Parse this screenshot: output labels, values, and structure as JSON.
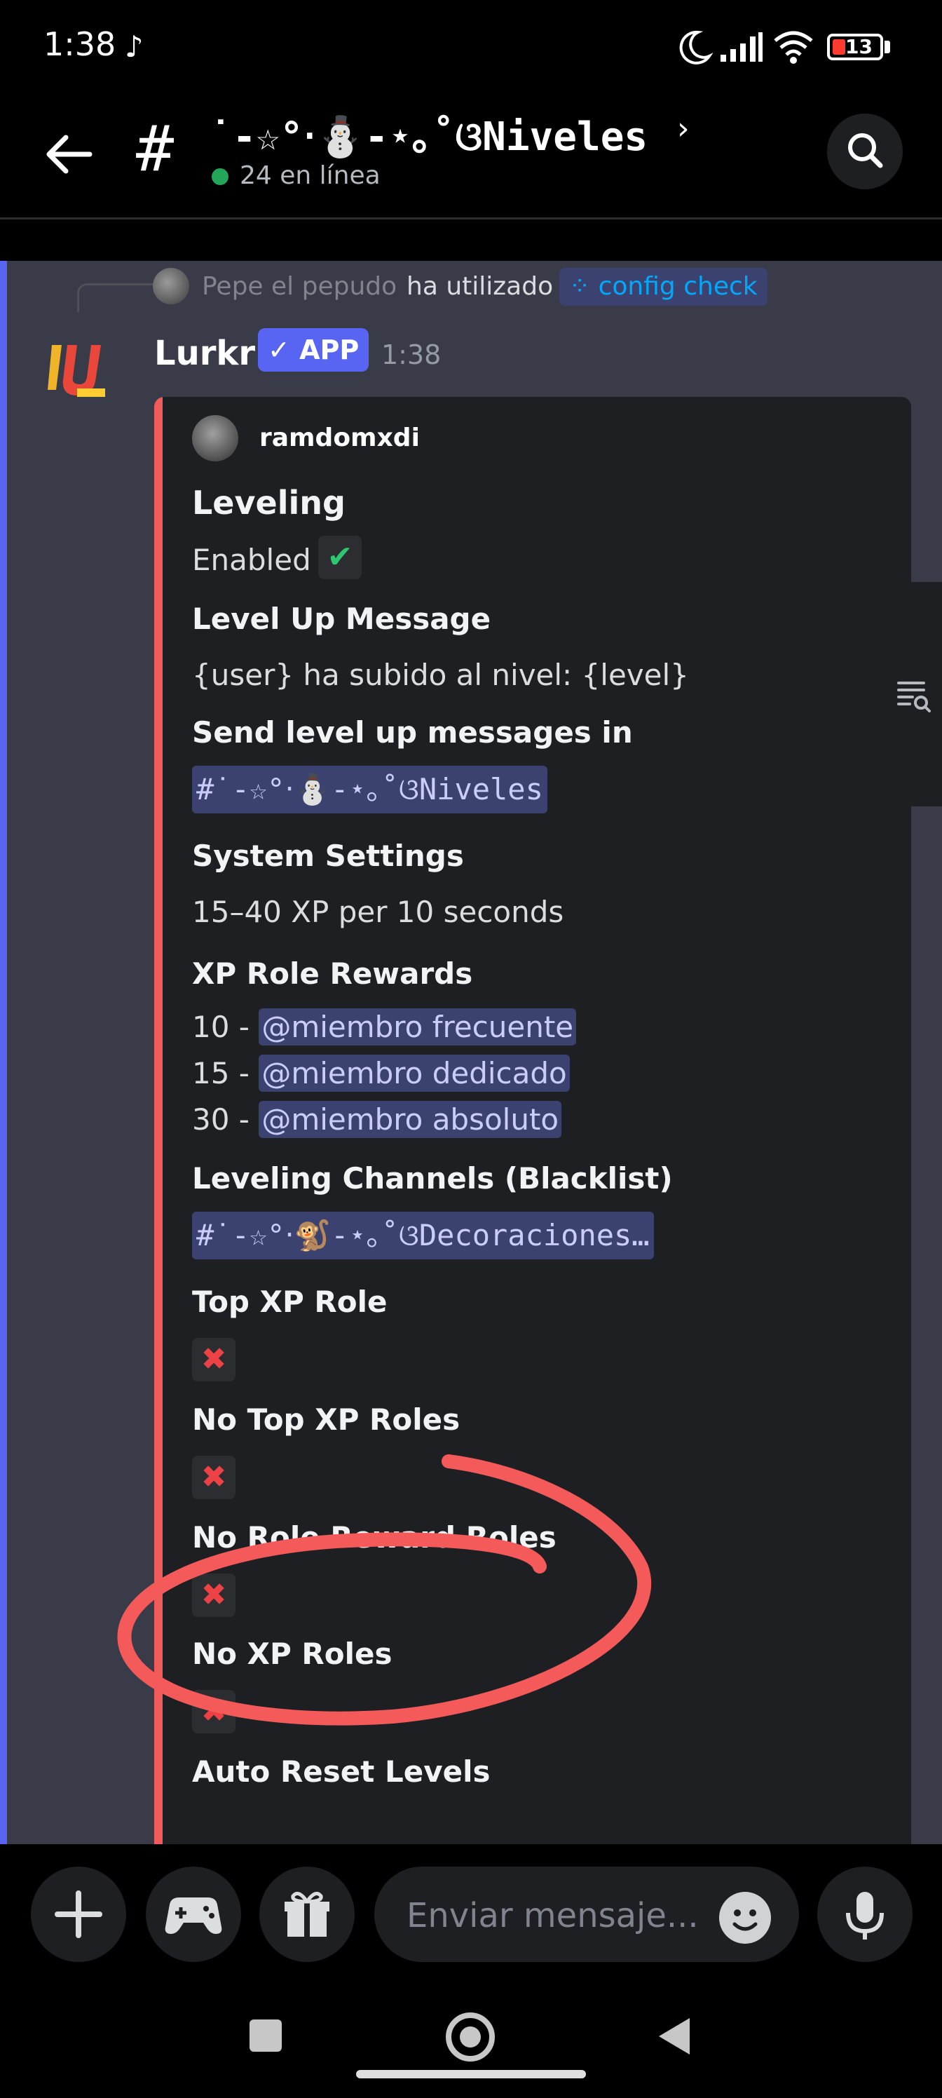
{
  "status_bar": {
    "time": "1:38",
    "battery": "13"
  },
  "channel_header": {
    "hash": "#",
    "channel_name": "˙-☆°‧⛄-⋆｡˚ଓNiveles",
    "chevron": "›",
    "online_text": "24 en línea"
  },
  "reply": {
    "user": "Pepe el pepudo",
    "used_text": "ha utilizado",
    "command": "config check"
  },
  "message": {
    "author": "Lurkr",
    "badge": "✓ APP",
    "time": "1:38"
  },
  "embed": {
    "author": "ramdomxdi",
    "title": "Leveling",
    "enabled_label": "Enabled",
    "enabled_icon": "✔",
    "fields": {
      "level_up_message": {
        "name": "Level Up Message",
        "value": "{user} ha subido al nivel: {level}"
      },
      "send_level_up": {
        "name": "Send level up messages in",
        "value": "#˙-☆°‧⛄-⋆｡˚ଓNiveles"
      },
      "system_settings": {
        "name": "System Settings",
        "value": "15–40 XP per 10 seconds"
      },
      "xp_role_rewards": {
        "name": "XP Role Rewards",
        "rewards": [
          {
            "level": "10 -",
            "role": "@miembro frecuente"
          },
          {
            "level": "15 -",
            "role": "@miembro dedicado"
          },
          {
            "level": "30 -",
            "role": "@miembro absoluto"
          }
        ]
      },
      "leveling_channels": {
        "name": "Leveling Channels (Blacklist)",
        "value": "#˙-☆°‧🐒-⋆｡˚ଓDecoraciones…"
      },
      "top_xp_role": {
        "name": "Top XP Role",
        "icon": "✖"
      },
      "no_top_xp_roles": {
        "name": "No Top XP Roles",
        "icon": "✖"
      },
      "no_role_reward_roles": {
        "name": "No Role Reward Roles",
        "icon": "✖"
      },
      "no_xp_roles": {
        "name": "No XP Roles",
        "icon": "✖"
      },
      "auto_reset_levels": {
        "name": "Auto Reset Levels"
      }
    }
  },
  "composer": {
    "placeholder": "Enviar mensaje..."
  },
  "colors": {
    "accent": "#5865f2",
    "embed_stripe": "#f25b5b",
    "annotation": "#f45a5a",
    "online": "#23a55a"
  }
}
